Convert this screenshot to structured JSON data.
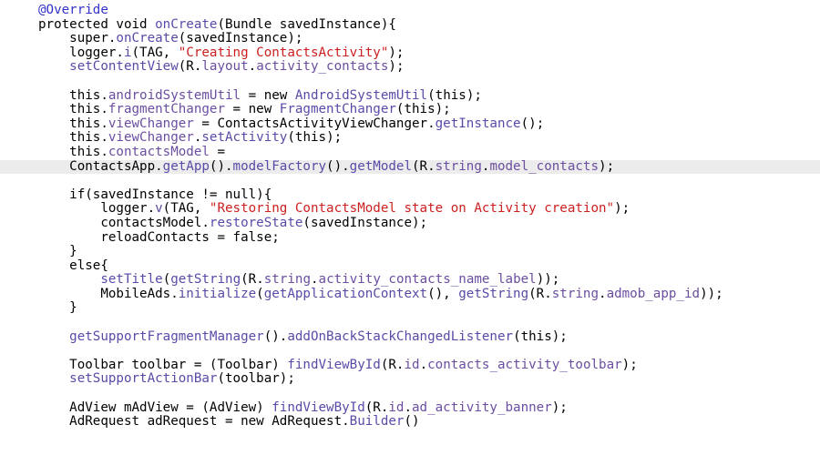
{
  "editor": {
    "lines": [
      [
        {
          "t": "@Override",
          "c": "a"
        }
      ],
      [
        {
          "t": "protected void ",
          "c": "k"
        },
        {
          "t": "onCreate",
          "c": "m"
        },
        {
          "t": "(Bundle savedInstance){",
          "c": "k"
        }
      ],
      [
        {
          "t": "    super.",
          "c": "k"
        },
        {
          "t": "onCreate",
          "c": "m"
        },
        {
          "t": "(savedInstance);",
          "c": "k"
        }
      ],
      [
        {
          "t": "    logger.",
          "c": "k"
        },
        {
          "t": "i",
          "c": "m"
        },
        {
          "t": "(TAG, ",
          "c": "k"
        },
        {
          "t": "\"Creating ContactsActivity\"",
          "c": "s"
        },
        {
          "t": ");",
          "c": "k"
        }
      ],
      [
        {
          "t": "    ",
          "c": "k"
        },
        {
          "t": "setContentView",
          "c": "m"
        },
        {
          "t": "(R.",
          "c": "k"
        },
        {
          "t": "layout",
          "c": "f"
        },
        {
          "t": ".",
          "c": "k"
        },
        {
          "t": "activity_contacts",
          "c": "f"
        },
        {
          "t": ");",
          "c": "k"
        }
      ],
      [],
      [
        {
          "t": "    this.",
          "c": "k"
        },
        {
          "t": "androidSystemUtil",
          "c": "f"
        },
        {
          "t": " = new ",
          "c": "k"
        },
        {
          "t": "AndroidSystemUtil",
          "c": "m"
        },
        {
          "t": "(this);",
          "c": "k"
        }
      ],
      [
        {
          "t": "    this.",
          "c": "k"
        },
        {
          "t": "fragmentChanger",
          "c": "f"
        },
        {
          "t": " = new ",
          "c": "k"
        },
        {
          "t": "FragmentChanger",
          "c": "m"
        },
        {
          "t": "(this);",
          "c": "k"
        }
      ],
      [
        {
          "t": "    this.",
          "c": "k"
        },
        {
          "t": "viewChanger",
          "c": "f"
        },
        {
          "t": " = ContactsActivityViewChanger.",
          "c": "k"
        },
        {
          "t": "getInstance",
          "c": "m"
        },
        {
          "t": "();",
          "c": "k"
        }
      ],
      [
        {
          "t": "    this.",
          "c": "k"
        },
        {
          "t": "viewChanger",
          "c": "f"
        },
        {
          "t": ".",
          "c": "k"
        },
        {
          "t": "setActivity",
          "c": "m"
        },
        {
          "t": "(this);",
          "c": "k"
        }
      ],
      [
        {
          "t": "    this.",
          "c": "k"
        },
        {
          "t": "contactsModel",
          "c": "f"
        },
        {
          "t": " =",
          "c": "k"
        }
      ],
      [
        {
          "t": "    ContactsApp.",
          "c": "k"
        },
        {
          "t": "getApp",
          "c": "m"
        },
        {
          "t": "().",
          "c": "k"
        },
        {
          "t": "modelFactory",
          "c": "m"
        },
        {
          "t": "().",
          "c": "k"
        },
        {
          "t": "getModel",
          "c": "m"
        },
        {
          "t": "(R.",
          "c": "k"
        },
        {
          "t": "string",
          "c": "f"
        },
        {
          "t": ".",
          "c": "k"
        },
        {
          "t": "model_contacts",
          "c": "f"
        },
        {
          "t": ");",
          "c": "k"
        }
      ],
      [],
      [
        {
          "t": "    if(savedInstance != null){",
          "c": "k"
        }
      ],
      [
        {
          "t": "        logger.",
          "c": "k"
        },
        {
          "t": "v",
          "c": "m"
        },
        {
          "t": "(TAG, ",
          "c": "k"
        },
        {
          "t": "\"Restoring ContactsModel state on Activity creation\"",
          "c": "s"
        },
        {
          "t": ");",
          "c": "k"
        }
      ],
      [
        {
          "t": "        contactsModel.",
          "c": "k"
        },
        {
          "t": "restoreState",
          "c": "m"
        },
        {
          "t": "(savedInstance);",
          "c": "k"
        }
      ],
      [
        {
          "t": "        reloadContacts = false;",
          "c": "k"
        }
      ],
      [
        {
          "t": "    }",
          "c": "k"
        }
      ],
      [
        {
          "t": "    else{",
          "c": "k"
        }
      ],
      [
        {
          "t": "        ",
          "c": "k"
        },
        {
          "t": "setTitle",
          "c": "m"
        },
        {
          "t": "(",
          "c": "k"
        },
        {
          "t": "getString",
          "c": "m"
        },
        {
          "t": "(R.",
          "c": "k"
        },
        {
          "t": "string",
          "c": "f"
        },
        {
          "t": ".",
          "c": "k"
        },
        {
          "t": "activity_contacts_name_label",
          "c": "f"
        },
        {
          "t": "));",
          "c": "k"
        }
      ],
      [
        {
          "t": "        MobileAds.",
          "c": "k"
        },
        {
          "t": "initialize",
          "c": "m"
        },
        {
          "t": "(",
          "c": "k"
        },
        {
          "t": "getApplicationContext",
          "c": "m"
        },
        {
          "t": "(), ",
          "c": "k"
        },
        {
          "t": "getString",
          "c": "m"
        },
        {
          "t": "(R.",
          "c": "k"
        },
        {
          "t": "string",
          "c": "f"
        },
        {
          "t": ".",
          "c": "k"
        },
        {
          "t": "admob_app_id",
          "c": "f"
        },
        {
          "t": "));",
          "c": "k"
        }
      ],
      [
        {
          "t": "    }",
          "c": "k"
        }
      ],
      [],
      [
        {
          "t": "    ",
          "c": "k"
        },
        {
          "t": "getSupportFragmentManager",
          "c": "m"
        },
        {
          "t": "().",
          "c": "k"
        },
        {
          "t": "addOnBackStackChangedListener",
          "c": "m"
        },
        {
          "t": "(this);",
          "c": "k"
        }
      ],
      [],
      [
        {
          "t": "    Toolbar toolbar = (Toolbar) ",
          "c": "k"
        },
        {
          "t": "findViewById",
          "c": "m"
        },
        {
          "t": "(R.",
          "c": "k"
        },
        {
          "t": "id",
          "c": "f"
        },
        {
          "t": ".",
          "c": "k"
        },
        {
          "t": "contacts_activity_toolbar",
          "c": "f"
        },
        {
          "t": ");",
          "c": "k"
        }
      ],
      [
        {
          "t": "    ",
          "c": "k"
        },
        {
          "t": "setSupportActionBar",
          "c": "m"
        },
        {
          "t": "(toolbar);",
          "c": "k"
        }
      ],
      [],
      [
        {
          "t": "    AdView mAdView = (AdView) ",
          "c": "k"
        },
        {
          "t": "findViewById",
          "c": "m"
        },
        {
          "t": "(R.",
          "c": "k"
        },
        {
          "t": "id",
          "c": "f"
        },
        {
          "t": ".",
          "c": "k"
        },
        {
          "t": "ad_activity_banner",
          "c": "f"
        },
        {
          "t": ");",
          "c": "k"
        }
      ],
      [
        {
          "t": "    AdRequest adRequest = new AdRequest.",
          "c": "k"
        },
        {
          "t": "Builder",
          "c": "m"
        },
        {
          "t": "()",
          "c": "k"
        }
      ]
    ],
    "current_line_index": 11,
    "colors": {
      "default": "#000000",
      "annotation": "#3333cc",
      "method": "#5a4aa8",
      "field": "#6b4ea0",
      "string": "#cc1f1f",
      "current_line_bg": "#ececec"
    }
  }
}
